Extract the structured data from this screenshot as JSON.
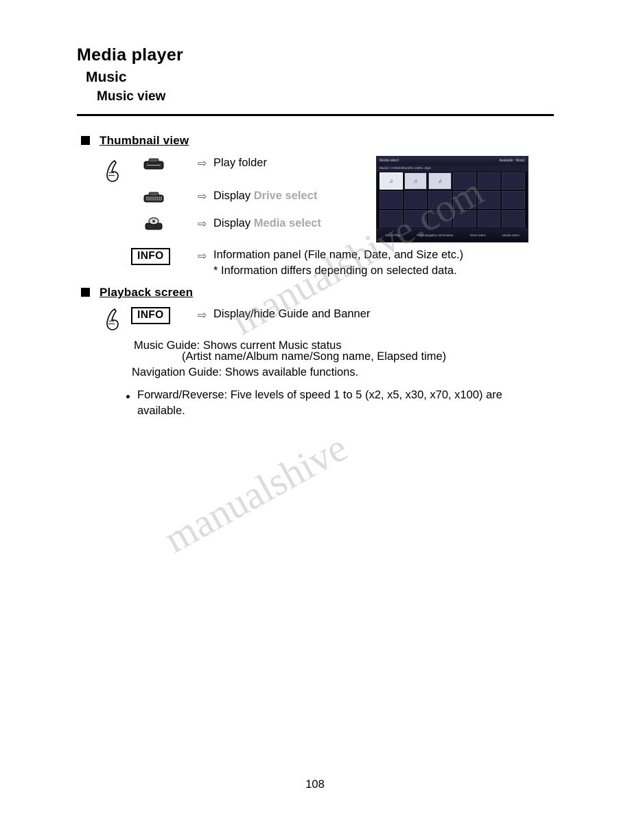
{
  "header": {
    "title": "Media player",
    "subtitle": "Music",
    "subsubtitle": "Music view"
  },
  "sections": [
    {
      "label": "Thumbnail view",
      "rows": [
        {
          "icon": "return-key-icon",
          "arrow": "⇨",
          "text": "Play folder",
          "grey": ""
        },
        {
          "icon": "channel-key-icon",
          "arrow": "⇨",
          "text": "Display ",
          "grey": "Drive select"
        },
        {
          "icon": "option-key-icon",
          "arrow": "⇨",
          "text": "Display ",
          "grey": "Media select"
        }
      ],
      "info_row": {
        "button": "INFO",
        "arrow": "⇨",
        "text": "Information panel (File name, Date, and Size etc.)",
        "note": "* Information differs depending on selected data."
      }
    },
    {
      "label": "Playback screen",
      "info_row": {
        "button": "INFO",
        "arrow": "⇨",
        "text": "Display/hide Guide and Banner"
      },
      "paragraphs": [
        "Music Guide: Shows current Music status",
        "(Artist name/Album name/Song name, Elapsed time)",
        "Navigation Guide: Shows available functions."
      ],
      "bullets": [
        "Forward/Reverse: Five levels of speed 1 to 5 (x2, x5, x30, x70, x100) are",
        "available."
      ]
    }
  ],
  "screen": {
    "top_left": "Media select",
    "top_right": "Available : Music",
    "path": "Music/ / /Artist/Album/01 x100x .mp3",
    "cells": [
      {
        "state": "sel",
        "glyph": "♫"
      },
      {
        "state": "lit",
        "glyph": "♫"
      },
      {
        "state": "lit",
        "glyph": "♫"
      },
      {
        "state": "normal",
        "glyph": ""
      },
      {
        "state": "normal",
        "glyph": ""
      },
      {
        "state": "normal",
        "glyph": ""
      },
      {
        "state": "normal",
        "glyph": ""
      },
      {
        "state": "normal",
        "glyph": ""
      },
      {
        "state": "normal",
        "glyph": ""
      },
      {
        "state": "normal",
        "glyph": ""
      },
      {
        "state": "normal",
        "glyph": ""
      },
      {
        "state": "normal",
        "glyph": ""
      },
      {
        "state": "normal",
        "glyph": ""
      },
      {
        "state": "normal",
        "glyph": ""
      },
      {
        "state": "normal",
        "glyph": ""
      },
      {
        "state": "normal",
        "glyph": ""
      },
      {
        "state": "normal",
        "glyph": ""
      },
      {
        "state": "normal",
        "glyph": ""
      }
    ],
    "bottom_items": [
      "Select  Play",
      "Play/navigation  Information",
      "Drive select",
      "Media select"
    ]
  },
  "watermark": {
    "line1": "manualshive.com",
    "line2": "manualshive"
  },
  "page_number": "108"
}
